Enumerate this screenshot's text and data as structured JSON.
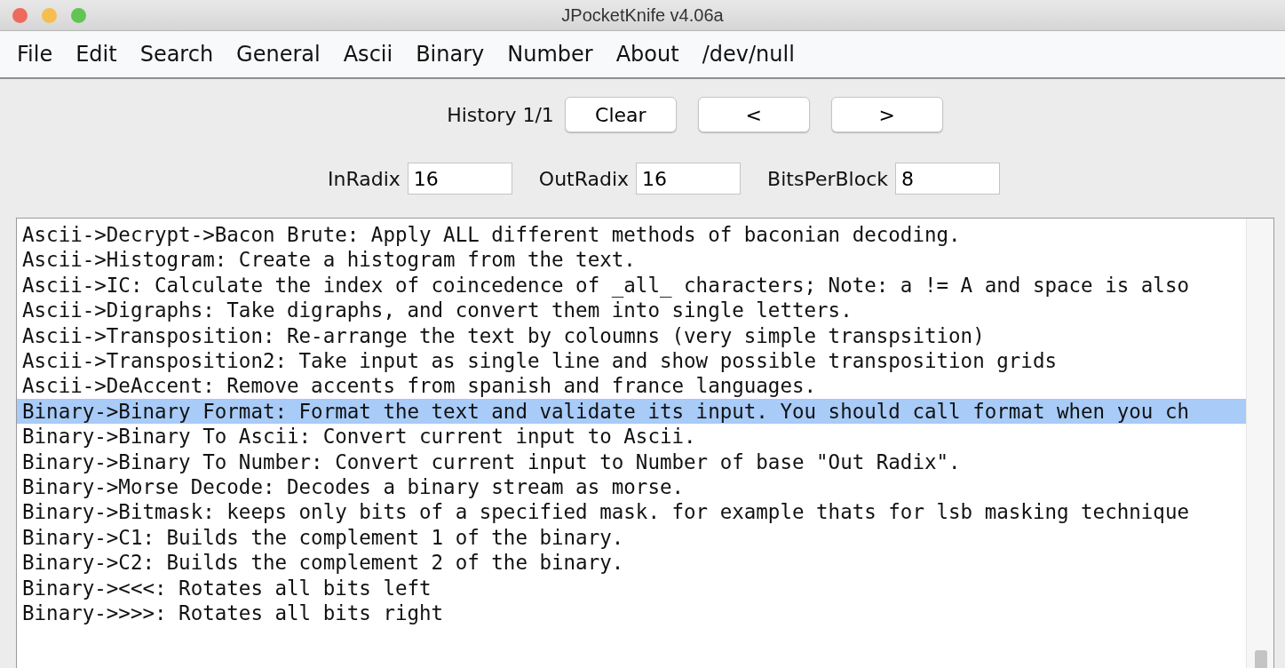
{
  "window": {
    "title": "JPocketKnife v4.06a"
  },
  "menu": [
    "File",
    "Edit",
    "Search",
    "General",
    "Ascii",
    "Binary",
    "Number",
    "About",
    "/dev/null"
  ],
  "history": {
    "label": "History 1/1",
    "buttons": [
      "Clear",
      "<",
      ">"
    ]
  },
  "radix_fields": [
    {
      "label": "InRadix",
      "value": "16"
    },
    {
      "label": "OutRadix",
      "value": "16"
    },
    {
      "label": "BitsPerBlock",
      "value": "8"
    }
  ],
  "lines": [
    {
      "text": "Ascii->Decrypt->Bacon Brute: Apply ALL different methods of baconian decoding.",
      "selected": false
    },
    {
      "text": "Ascii->Histogram: Create a histogram from the text.",
      "selected": false
    },
    {
      "text": "Ascii->IC: Calculate the index of coincedence of _all_ characters; Note: a != A and space is also",
      "selected": false
    },
    {
      "text": "Ascii->Digraphs: Take digraphs, and convert them into single letters.",
      "selected": false
    },
    {
      "text": "Ascii->Transposition: Re-arrange the text by coloumns (very simple transpsition)",
      "selected": false
    },
    {
      "text": "Ascii->Transposition2: Take input as single line and show possible transposition grids",
      "selected": false
    },
    {
      "text": "Ascii->DeAccent: Remove accents from spanish and france languages.",
      "selected": false
    },
    {
      "text": "Binary->Binary Format: Format the text and validate its input. You should call format when you ch",
      "selected": true
    },
    {
      "text": "Binary->Binary To Ascii: Convert current input to Ascii.",
      "selected": false
    },
    {
      "text": "Binary->Binary To Number: Convert current input to Number of base \"Out Radix\".",
      "selected": false
    },
    {
      "text": "Binary->Morse Decode: Decodes a binary stream as morse.",
      "selected": false
    },
    {
      "text": "Binary->Bitmask: keeps only bits of a specified mask. for example thats for lsb masking technique",
      "selected": false
    },
    {
      "text": "Binary->C1: Builds the complement 1 of the binary.",
      "selected": false
    },
    {
      "text": "Binary->C2: Builds the complement 2 of the binary.",
      "selected": false
    },
    {
      "text": "Binary-><<<: Rotates all bits left",
      "selected": false
    },
    {
      "text": "Binary->>>>: Rotates all bits right",
      "selected": false
    }
  ]
}
